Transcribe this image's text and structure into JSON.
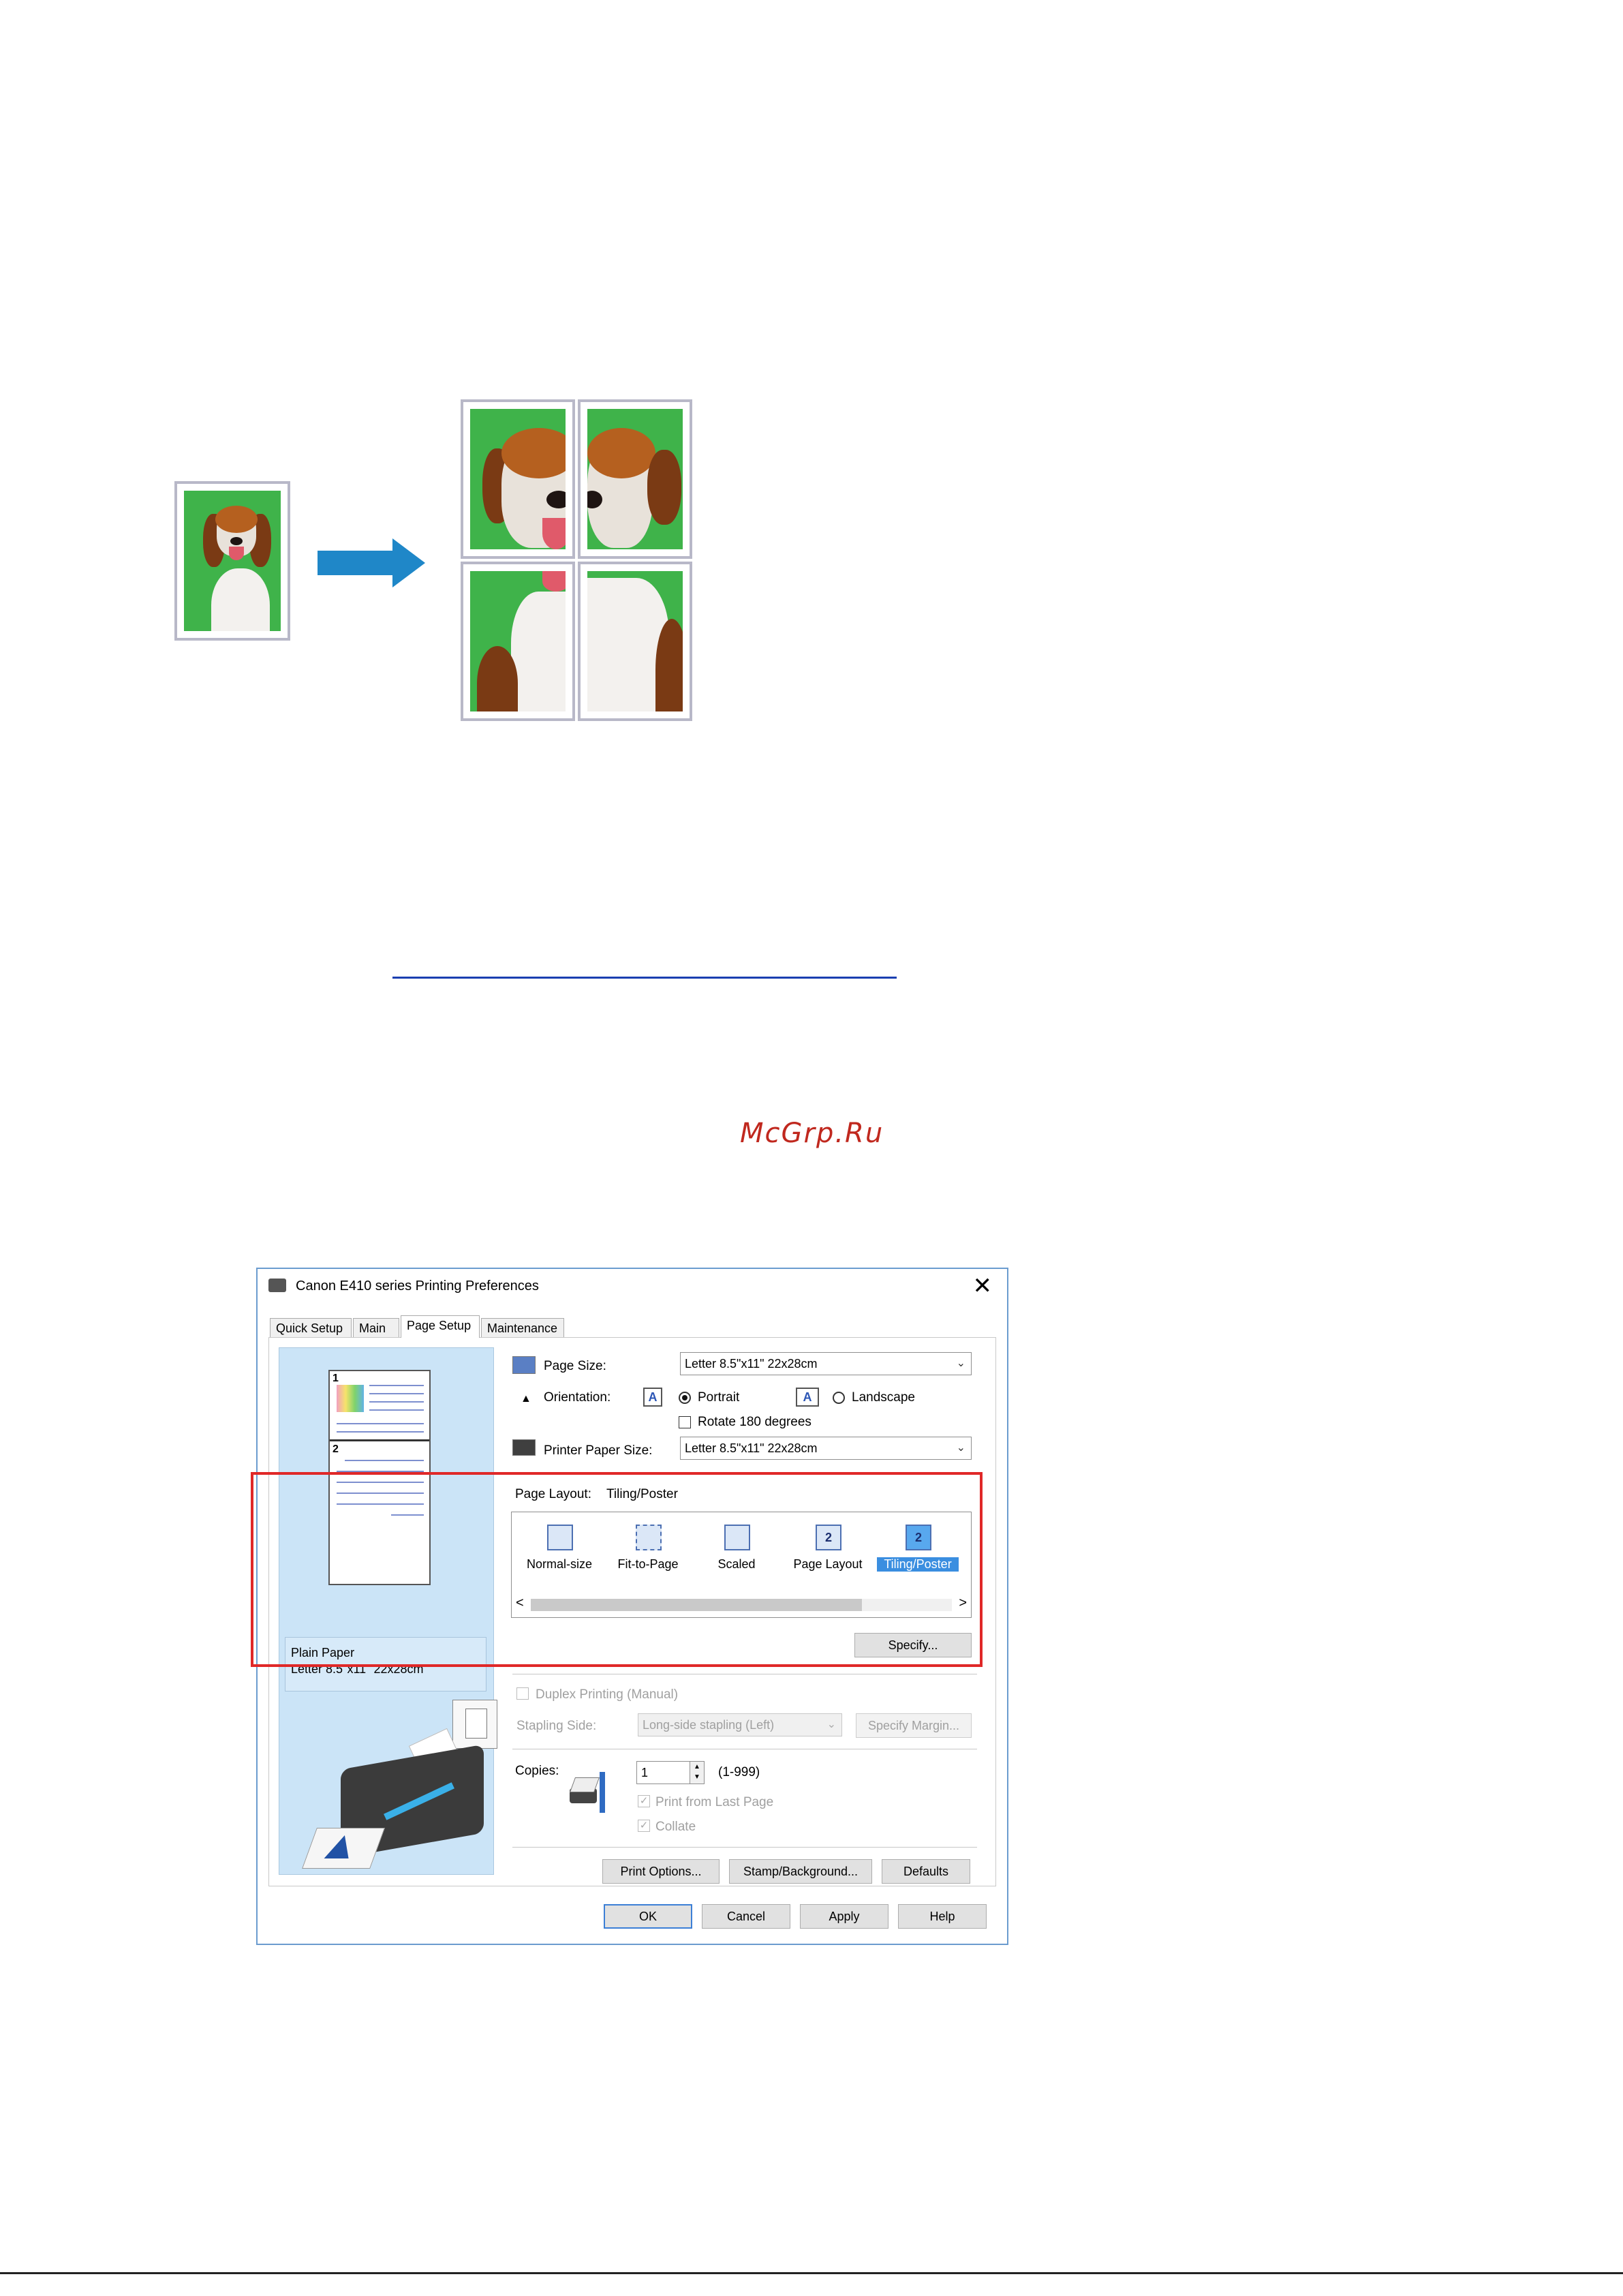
{
  "illustration": {
    "original_label": "",
    "tiled_label": ""
  },
  "watermark": "McGrp.Ru",
  "dialog": {
    "title": "Canon E410 series Printing Preferences",
    "close_glyph": "✕",
    "tabs": [
      {
        "label": "Quick Setup"
      },
      {
        "label": "Main"
      },
      {
        "label": "Page Setup"
      },
      {
        "label": "Maintenance"
      }
    ],
    "active_tab": "Page Setup",
    "preview": {
      "page1_num": "1",
      "page2_num": "2",
      "media_line1": "Plain Paper",
      "media_line2": "Letter 8.5\"x11\" 22x28cm"
    },
    "page_size": {
      "label": "Page Size:",
      "value": "Letter 8.5\"x11\" 22x28cm"
    },
    "orientation": {
      "label": "Orientation:",
      "portrait": "Portrait",
      "landscape": "Landscape",
      "selected": "Portrait",
      "rotate_label": "Rotate 180 degrees"
    },
    "printer_paper_size": {
      "label": "Printer Paper Size:",
      "value": "Letter 8.5\"x11\" 22x28cm"
    },
    "page_layout": {
      "label": "Page Layout:",
      "value": "Tiling/Poster",
      "options": [
        {
          "label": "Normal-size",
          "glyph": ""
        },
        {
          "label": "Fit-to-Page",
          "glyph": ""
        },
        {
          "label": "Scaled",
          "glyph": ""
        },
        {
          "label": "Page Layout",
          "glyph": "2"
        },
        {
          "label": "Tiling/Poster",
          "glyph": "2"
        }
      ],
      "selected": "Tiling/Poster",
      "scroll_left": "<",
      "scroll_right": ">",
      "specify_button": "Specify..."
    },
    "duplex": {
      "label": "Duplex Printing (Manual)",
      "stapling_label": "Stapling Side:",
      "stapling_value": "Long-side stapling (Left)",
      "specify_margin_button": "Specify Margin..."
    },
    "copies": {
      "label": "Copies:",
      "value": "1",
      "range": "(1-999)",
      "print_from_last": "Print from Last Page",
      "collate": "Collate"
    },
    "buttons": {
      "print_options": "Print Options...",
      "stamp_background": "Stamp/Background...",
      "defaults": "Defaults",
      "ok": "OK",
      "cancel": "Cancel",
      "apply": "Apply",
      "help": "Help"
    },
    "colors": {
      "highlight_border": "#e02828",
      "selection": "#3a8ee0",
      "preview_bg": "#cbe4f7",
      "window_border": "#6b9ccf"
    }
  }
}
